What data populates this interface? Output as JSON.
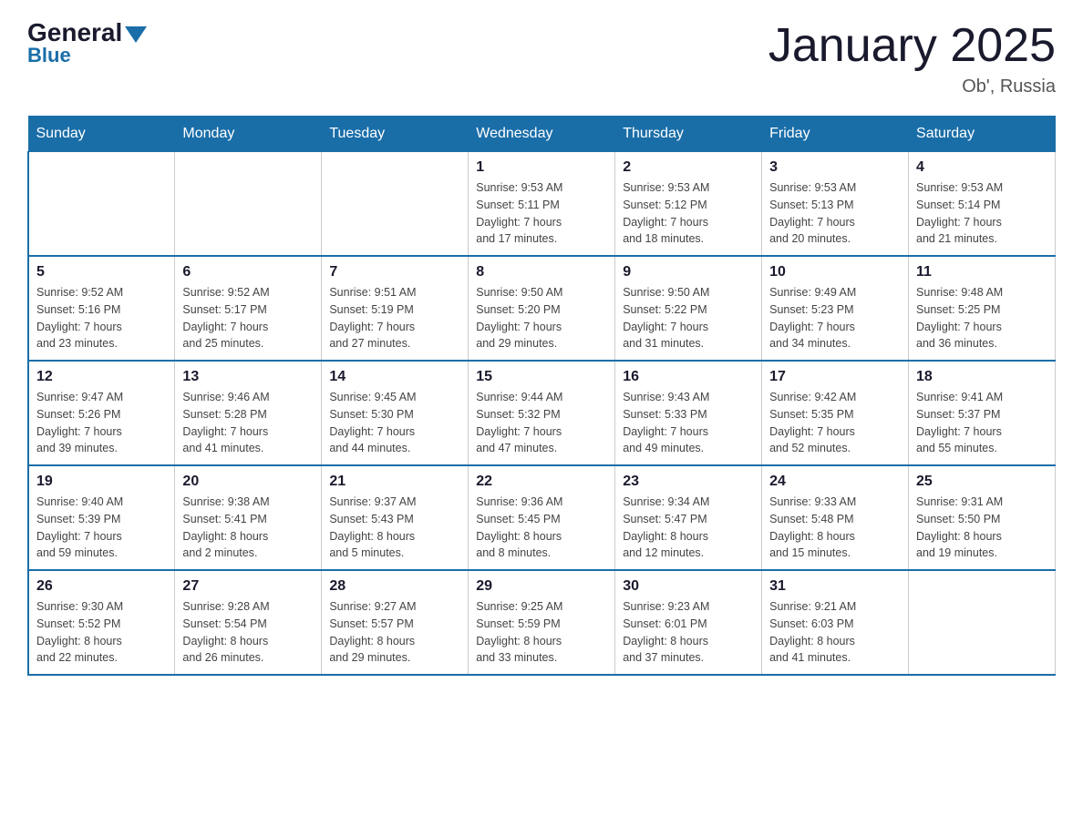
{
  "logo": {
    "general_text": "General",
    "blue_text": "Blue"
  },
  "header": {
    "title": "January 2025",
    "location": "Ob', Russia"
  },
  "days_of_week": [
    "Sunday",
    "Monday",
    "Tuesday",
    "Wednesday",
    "Thursday",
    "Friday",
    "Saturday"
  ],
  "weeks": [
    [
      {
        "day": "",
        "info": ""
      },
      {
        "day": "",
        "info": ""
      },
      {
        "day": "",
        "info": ""
      },
      {
        "day": "1",
        "info": "Sunrise: 9:53 AM\nSunset: 5:11 PM\nDaylight: 7 hours\nand 17 minutes."
      },
      {
        "day": "2",
        "info": "Sunrise: 9:53 AM\nSunset: 5:12 PM\nDaylight: 7 hours\nand 18 minutes."
      },
      {
        "day": "3",
        "info": "Sunrise: 9:53 AM\nSunset: 5:13 PM\nDaylight: 7 hours\nand 20 minutes."
      },
      {
        "day": "4",
        "info": "Sunrise: 9:53 AM\nSunset: 5:14 PM\nDaylight: 7 hours\nand 21 minutes."
      }
    ],
    [
      {
        "day": "5",
        "info": "Sunrise: 9:52 AM\nSunset: 5:16 PM\nDaylight: 7 hours\nand 23 minutes."
      },
      {
        "day": "6",
        "info": "Sunrise: 9:52 AM\nSunset: 5:17 PM\nDaylight: 7 hours\nand 25 minutes."
      },
      {
        "day": "7",
        "info": "Sunrise: 9:51 AM\nSunset: 5:19 PM\nDaylight: 7 hours\nand 27 minutes."
      },
      {
        "day": "8",
        "info": "Sunrise: 9:50 AM\nSunset: 5:20 PM\nDaylight: 7 hours\nand 29 minutes."
      },
      {
        "day": "9",
        "info": "Sunrise: 9:50 AM\nSunset: 5:22 PM\nDaylight: 7 hours\nand 31 minutes."
      },
      {
        "day": "10",
        "info": "Sunrise: 9:49 AM\nSunset: 5:23 PM\nDaylight: 7 hours\nand 34 minutes."
      },
      {
        "day": "11",
        "info": "Sunrise: 9:48 AM\nSunset: 5:25 PM\nDaylight: 7 hours\nand 36 minutes."
      }
    ],
    [
      {
        "day": "12",
        "info": "Sunrise: 9:47 AM\nSunset: 5:26 PM\nDaylight: 7 hours\nand 39 minutes."
      },
      {
        "day": "13",
        "info": "Sunrise: 9:46 AM\nSunset: 5:28 PM\nDaylight: 7 hours\nand 41 minutes."
      },
      {
        "day": "14",
        "info": "Sunrise: 9:45 AM\nSunset: 5:30 PM\nDaylight: 7 hours\nand 44 minutes."
      },
      {
        "day": "15",
        "info": "Sunrise: 9:44 AM\nSunset: 5:32 PM\nDaylight: 7 hours\nand 47 minutes."
      },
      {
        "day": "16",
        "info": "Sunrise: 9:43 AM\nSunset: 5:33 PM\nDaylight: 7 hours\nand 49 minutes."
      },
      {
        "day": "17",
        "info": "Sunrise: 9:42 AM\nSunset: 5:35 PM\nDaylight: 7 hours\nand 52 minutes."
      },
      {
        "day": "18",
        "info": "Sunrise: 9:41 AM\nSunset: 5:37 PM\nDaylight: 7 hours\nand 55 minutes."
      }
    ],
    [
      {
        "day": "19",
        "info": "Sunrise: 9:40 AM\nSunset: 5:39 PM\nDaylight: 7 hours\nand 59 minutes."
      },
      {
        "day": "20",
        "info": "Sunrise: 9:38 AM\nSunset: 5:41 PM\nDaylight: 8 hours\nand 2 minutes."
      },
      {
        "day": "21",
        "info": "Sunrise: 9:37 AM\nSunset: 5:43 PM\nDaylight: 8 hours\nand 5 minutes."
      },
      {
        "day": "22",
        "info": "Sunrise: 9:36 AM\nSunset: 5:45 PM\nDaylight: 8 hours\nand 8 minutes."
      },
      {
        "day": "23",
        "info": "Sunrise: 9:34 AM\nSunset: 5:47 PM\nDaylight: 8 hours\nand 12 minutes."
      },
      {
        "day": "24",
        "info": "Sunrise: 9:33 AM\nSunset: 5:48 PM\nDaylight: 8 hours\nand 15 minutes."
      },
      {
        "day": "25",
        "info": "Sunrise: 9:31 AM\nSunset: 5:50 PM\nDaylight: 8 hours\nand 19 minutes."
      }
    ],
    [
      {
        "day": "26",
        "info": "Sunrise: 9:30 AM\nSunset: 5:52 PM\nDaylight: 8 hours\nand 22 minutes."
      },
      {
        "day": "27",
        "info": "Sunrise: 9:28 AM\nSunset: 5:54 PM\nDaylight: 8 hours\nand 26 minutes."
      },
      {
        "day": "28",
        "info": "Sunrise: 9:27 AM\nSunset: 5:57 PM\nDaylight: 8 hours\nand 29 minutes."
      },
      {
        "day": "29",
        "info": "Sunrise: 9:25 AM\nSunset: 5:59 PM\nDaylight: 8 hours\nand 33 minutes."
      },
      {
        "day": "30",
        "info": "Sunrise: 9:23 AM\nSunset: 6:01 PM\nDaylight: 8 hours\nand 37 minutes."
      },
      {
        "day": "31",
        "info": "Sunrise: 9:21 AM\nSunset: 6:03 PM\nDaylight: 8 hours\nand 41 minutes."
      },
      {
        "day": "",
        "info": ""
      }
    ]
  ]
}
